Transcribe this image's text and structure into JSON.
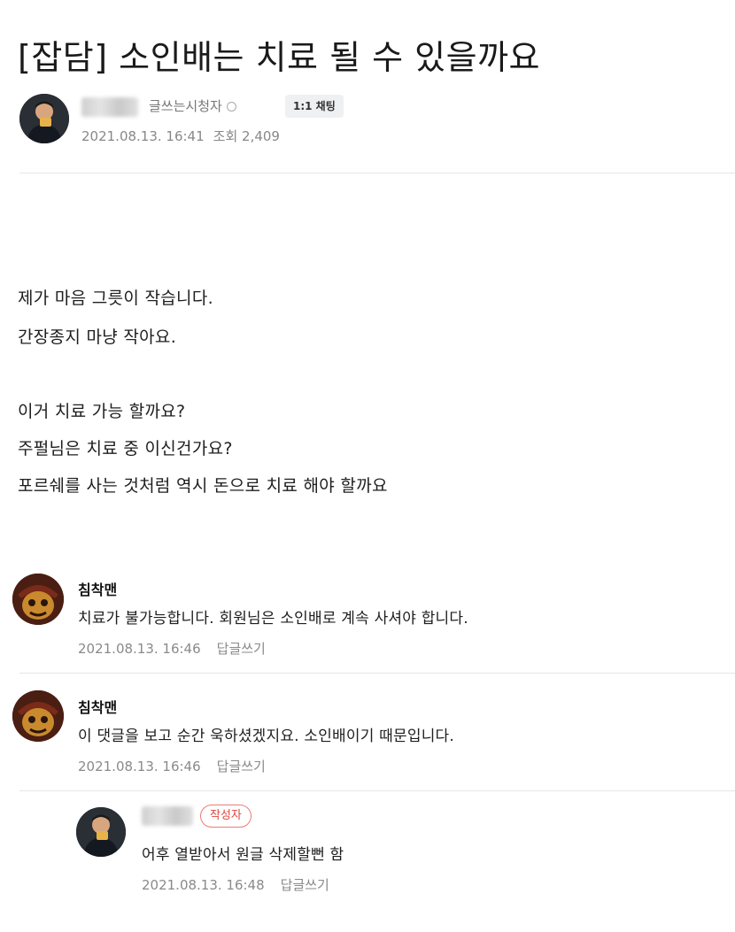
{
  "post": {
    "title": "[잡담] 소인배는 치료 될 수 있을까요",
    "author_grade": "글쓰는시청자",
    "chat_button": "1:1 채팅",
    "date": "2021.08.13. 16:41",
    "views": "조회 2,409",
    "body": [
      "제가 마음 그릇이 작습니다.",
      "간장종지 마냥 작아요.",
      "이거 치료 가능 할까요?",
      "주펄님은 치료 중 이신건가요?",
      "포르쉐를 사는 것처럼 역시 돈으로 치료 해야 할까요"
    ]
  },
  "comments": [
    {
      "nickname": "침착맨",
      "text": "치료가 불가능합니다. 회원님은 소인배로 계속 사셔야 합니다.",
      "date": "2021.08.13. 16:46",
      "reply": "답글쓰기"
    },
    {
      "nickname": "침착맨",
      "text": "이 댓글을 보고 순간 욱하셨겠지요. 소인배이기 때문입니다.",
      "date": "2021.08.13. 16:46",
      "reply": "답글쓰기"
    },
    {
      "badge": "작성자",
      "text": "어후 열받아서 원글 삭제할뻔 함",
      "date": "2021.08.13. 16:48",
      "reply": "답글쓰기"
    }
  ]
}
